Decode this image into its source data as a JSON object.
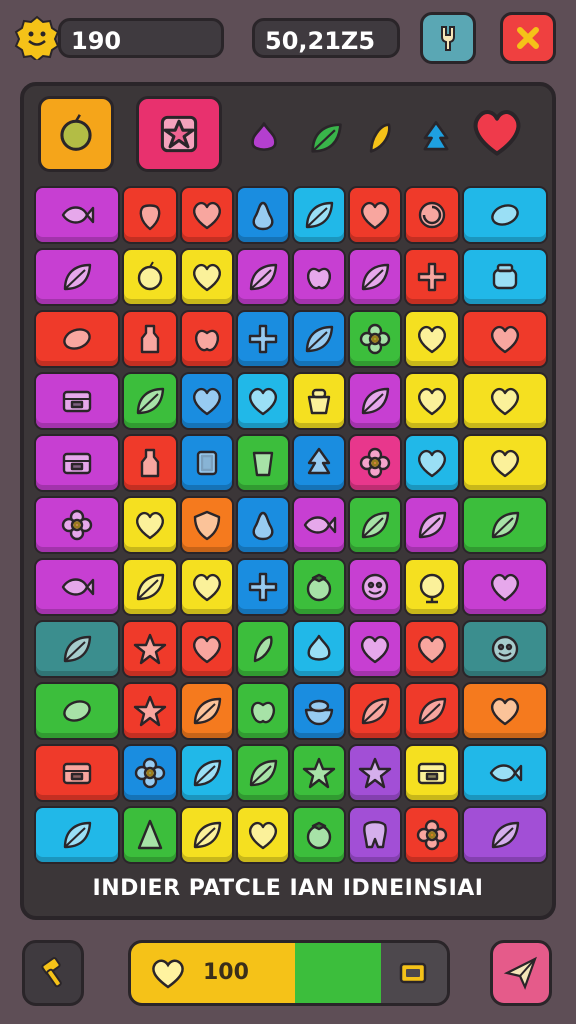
{
  "hud": {
    "coins": "190",
    "score": "50,21Z5",
    "face_icon": "smiley-face-icon",
    "tool_icon": "wrench-icon",
    "close_icon": "close-icon"
  },
  "powerups": [
    {
      "name": "lime-powerup",
      "color": "#f5a51a",
      "icon": "lime-icon"
    },
    {
      "name": "pink-crate-powerup",
      "color": "#e8316e",
      "icon": "star-crate-icon"
    },
    {
      "name": "purple-onion",
      "color": "#b43fcf",
      "icon": "onion-icon"
    },
    {
      "name": "green-leaf",
      "color": "#39b54a",
      "icon": "leaf-icon"
    },
    {
      "name": "yellow-corn",
      "color": "#f5c218",
      "icon": "corn-icon"
    },
    {
      "name": "blue-tree",
      "color": "#1ea0e0",
      "icon": "tree-icon"
    },
    {
      "name": "red-heart",
      "color": "#ef3a4b",
      "icon": "heart-icon"
    }
  ],
  "colors": {
    "magenta": "#c73fd2",
    "red": "#ef3a2a",
    "blue": "#1a8de0",
    "cyan": "#21b8e8",
    "yellow": "#f5e020",
    "green": "#3cbe3c",
    "orange": "#f57a1e",
    "teal": "#3b8e8e",
    "pink": "#e8378c",
    "purple": "#a24fd6"
  },
  "board": {
    "rows": [
      [
        "magenta:fish",
        "red:strawberry",
        "red:heart",
        "blue:pear",
        "cyan:leaf",
        "red:heart",
        "red:swirl",
        "cyan:lemon"
      ],
      [
        "magenta:leaf",
        "yellow:lime",
        "yellow:heart",
        "magenta:leaf",
        "magenta:apple",
        "magenta:leaf",
        "red:cross",
        "cyan:jar"
      ],
      [
        "red:lemon",
        "red:bottle",
        "red:apple",
        "blue:cross",
        "blue:leaf",
        "green:flower",
        "yellow:heart",
        "red:heart"
      ],
      [
        "magenta:box",
        "green:leaf",
        "blue:heart",
        "cyan:heart",
        "yellow:pot",
        "magenta:leaf",
        "yellow:heart",
        "yellow:heart"
      ],
      [
        "magenta:box",
        "red:bottle",
        "blue:square",
        "green:cup",
        "blue:tree",
        "pink:flower",
        "cyan:heart",
        "yellow:heart"
      ],
      [
        "magenta:flower",
        "yellow:heart",
        "orange:shield",
        "blue:pear",
        "magenta:fish",
        "green:leaf",
        "magenta:leaf",
        "green:leaf"
      ],
      [
        "magenta:fish",
        "yellow:leaf",
        "yellow:heart",
        "blue:cross",
        "green:tomato",
        "magenta:face",
        "yellow:globe",
        "magenta:heart"
      ],
      [
        "teal:leaf",
        "red:star",
        "red:heart",
        "green:corn",
        "cyan:onion",
        "magenta:heart",
        "red:heart",
        "teal:face"
      ],
      [
        "green:lemon",
        "red:star",
        "orange:leaf",
        "green:apple",
        "blue:bowl",
        "red:leaf",
        "red:leaf",
        "orange:heart"
      ],
      [
        "red:box",
        "blue:flower",
        "cyan:leaf",
        "green:leaf",
        "green:star",
        "purple:star",
        "yellow:box",
        "cyan:fish"
      ],
      [
        "cyan:leaf",
        "green:cone",
        "yellow:leaf",
        "yellow:heart",
        "green:tomato",
        "purple:tooth",
        "red:flower",
        "purple:leaf"
      ]
    ]
  },
  "caption": "INDIER PATCLE IAN IDNEINSIAI",
  "meter": {
    "label": "100",
    "yellow_fraction": 0.52,
    "green_fraction": 0.28,
    "heart_icon": "heart-icon",
    "end_icon": "ticket-icon"
  },
  "bottom": {
    "left_icon": "hammer-icon",
    "right_icon": "paper-plane-icon"
  }
}
